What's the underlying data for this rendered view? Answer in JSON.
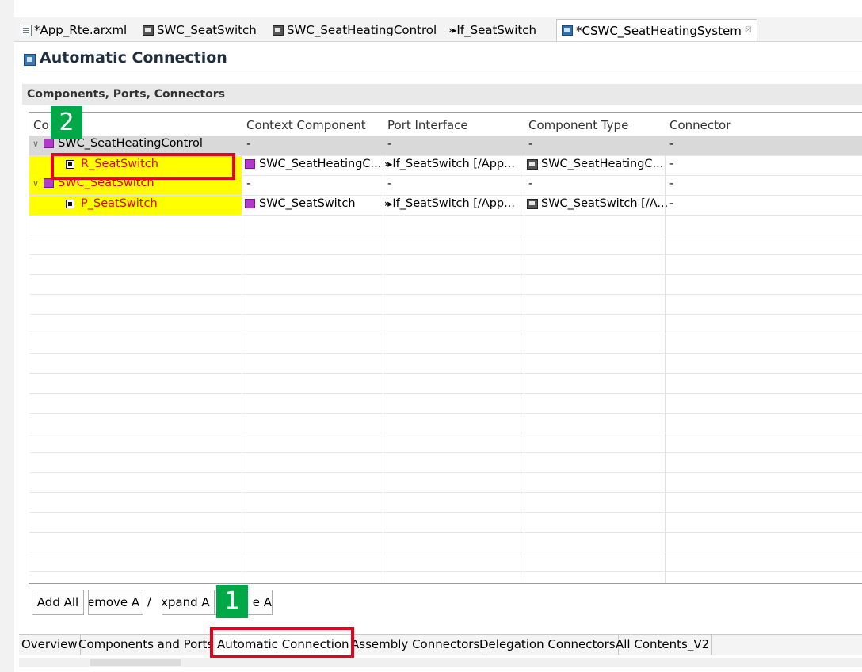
{
  "editor_tabs": [
    {
      "label": "*App_Rte.arxml",
      "icon": "arxml-file-icon"
    },
    {
      "label": "SWC_SeatSwitch",
      "icon": "swc-type-icon"
    },
    {
      "label": "SWC_SeatHeatingControl",
      "icon": "swc-type-icon"
    },
    {
      "label": "If_SeatSwitch",
      "icon": "interface-icon"
    },
    {
      "label": "*CSWC_SeatHeatingSystem",
      "icon": "composition-icon",
      "close": "☒"
    }
  ],
  "header": {
    "title": "Automatic Connection"
  },
  "section": {
    "title": "Components, Ports, Connectors"
  },
  "table": {
    "columns": [
      "Co",
      "Context Component",
      "Port Interface",
      "Component Type",
      "Connector"
    ],
    "rows": [
      {
        "name": "SWC_SeatHeatingControl",
        "context": "-",
        "iface": "-",
        "ctype": "-",
        "connector": "-"
      },
      {
        "name": "R_SeatSwitch",
        "context": "SWC_SeatHeatingC...",
        "iface": "If_SeatSwitch [/App...",
        "ctype": "SWC_SeatHeatingC...",
        "connector": "-"
      },
      {
        "name": "SWC_SeatSwitch",
        "context": "-",
        "iface": "-",
        "ctype": "-",
        "connector": "-"
      },
      {
        "name": "P_SeatSwitch",
        "context": "SWC_SeatSwitch",
        "iface": "If_SeatSwitch [/App...",
        "ctype": "SWC_SeatSwitch [/A...",
        "connector": "-"
      }
    ],
    "highlight_color": "#ffff00"
  },
  "buttons": {
    "add_all": "Add All",
    "remove_all": "⁠emove A",
    "slash": "/",
    "expand_all": "⁠xpand A",
    "collapse_all": "e A"
  },
  "page_tabs": [
    "Overview",
    "Components and Ports",
    "Automatic Connection",
    "Assembly Connectors",
    "Delegation Connectors",
    "All Contents_V2"
  ],
  "annotations": {
    "step1": "1",
    "step2": "2",
    "color": "#e8001c",
    "badge_color": "#00a847"
  }
}
